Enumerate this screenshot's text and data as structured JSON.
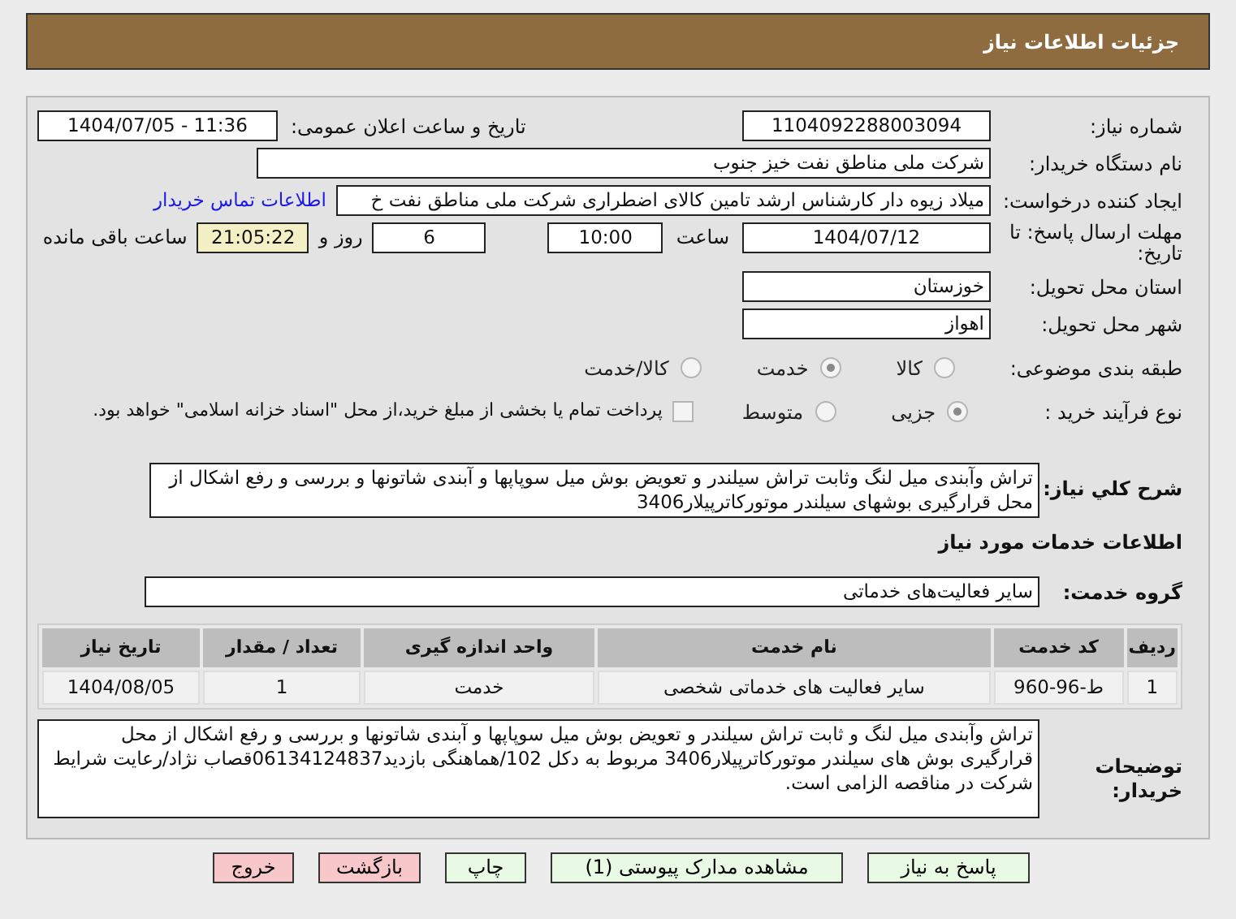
{
  "header": {
    "title": "جزئیات اطلاعات نیاز"
  },
  "need_number": {
    "label": "شماره نیاز:",
    "value": "1104092288003094"
  },
  "announce": {
    "label": "تاریخ و ساعت اعلان عمومی:",
    "value": "1404/07/05 - 11:36"
  },
  "buyer_org": {
    "label": "نام دستگاه خریدار:",
    "value": "شرکت ملی مناطق نفت خیز جنوب"
  },
  "requester": {
    "label": "ایجاد کننده درخواست:",
    "value": "میلاد زیوه دار  کارشناس ارشد تامین کالای اضطراری شرکت ملی مناطق نفت خ",
    "link": "اطلاعات تماس خریدار"
  },
  "deadline": {
    "label": "مهلت ارسال پاسخ: تا تاریخ:",
    "date": "1404/07/12",
    "time_label": "ساعت",
    "time": "10:00",
    "days": "6",
    "days_label": "روز و",
    "remaining": "21:05:22",
    "remaining_label": "ساعت باقی مانده"
  },
  "province": {
    "label": "استان محل تحویل:",
    "value": "خوزستان"
  },
  "city": {
    "label": "شهر محل تحویل:",
    "value": "اهواز"
  },
  "category": {
    "label": "طبقه بندی موضوعی:",
    "options": [
      {
        "label": "کالا",
        "selected": false
      },
      {
        "label": "خدمت",
        "selected": true
      },
      {
        "label": "کالا/خدمت",
        "selected": false
      }
    ]
  },
  "process": {
    "label": "نوع فرآیند خرید :",
    "options": [
      {
        "label": "جزیی",
        "selected": true
      },
      {
        "label": "متوسط",
        "selected": false
      }
    ],
    "payment": {
      "label": "پرداخت تمام یا بخشی از مبلغ خرید،از محل \"اسناد خزانه اسلامی\" خواهد بود.",
      "checked": false
    }
  },
  "summary": {
    "label": "شرح کلي نياز:",
    "value": "تراش وآبندی میل لنگ وثابت تراش سیلندر و تعویض بوش میل سوپاپها و آبندی شاتونها و بررسی و رفع اشکال از محل قرارگیری بوشهای سیلندر موتورکاترپیلار3406"
  },
  "services_heading": "اطلاعات خدمات مورد نیاز",
  "service_group": {
    "label": "گروه خدمت:",
    "value": "سایر فعالیت‌های خدماتی"
  },
  "table": {
    "columns": [
      "ردیف",
      "کد خدمت",
      "نام خدمت",
      "واحد اندازه گیری",
      "تعداد / مقدار",
      "تاریخ نیاز"
    ],
    "rows": [
      [
        "1",
        "ط-96-960",
        "سایر فعالیت های خدماتی شخصی",
        "خدمت",
        "1",
        "1404/08/05"
      ]
    ]
  },
  "buyer_notes": {
    "label": "توضیحات خریدار:",
    "value": "تراش وآبندی میل لنگ و ثابت تراش سیلندر و تعویض بوش میل سوپاپها و آبندی شاتونها و بررسی و رفع اشکال از محل قرارگیری بوش های سیلندر موتورکاترپیلار3406 مربوط به دکل 102/هماهنگی بازدید06134124837قصاب نژاد/رعایت شرایط شرکت در مناقصه الزامی است."
  },
  "buttons": [
    {
      "label": "پاسخ به نیاز",
      "kind": "normal"
    },
    {
      "label": "مشاهده مدارک پیوستی (1)",
      "kind": "normal"
    },
    {
      "label": "چاپ",
      "kind": "normal"
    },
    {
      "label": "بازگشت",
      "kind": "danger"
    },
    {
      "label": "خروج",
      "kind": "danger"
    }
  ]
}
